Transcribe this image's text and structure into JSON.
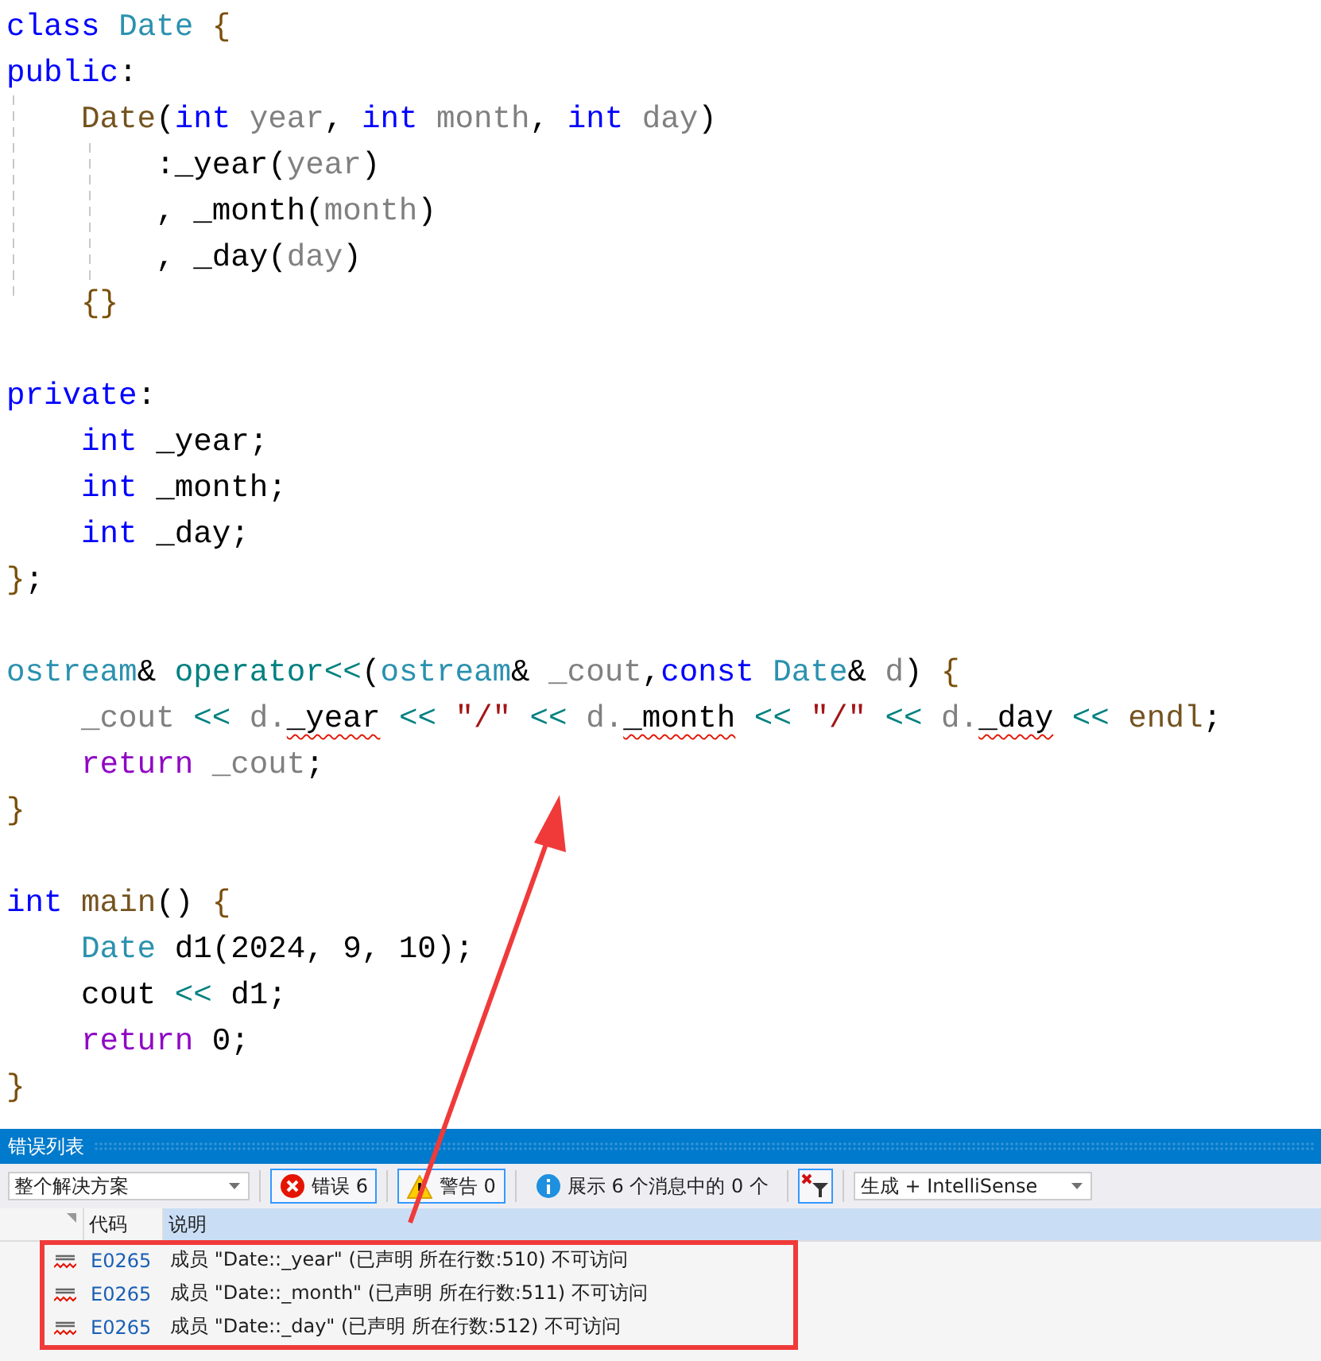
{
  "editor": {
    "lines": [
      {
        "kind": "code",
        "tokens": [
          {
            "kind": "kw",
            "text": "class "
          },
          {
            "kind": "type",
            "text": "Date "
          },
          {
            "kind": "brace",
            "text": "{"
          }
        ]
      },
      {
        "kind": "code",
        "tokens": [
          {
            "kind": "kw",
            "text": "public"
          },
          {
            "kind": "plain",
            "text": ":"
          }
        ]
      },
      {
        "kind": "code",
        "tokens": [
          {
            "kind": "fn",
            "text": "    Date"
          },
          {
            "kind": "plain",
            "text": "("
          },
          {
            "kind": "kw",
            "text": "int "
          },
          {
            "kind": "param",
            "text": "year"
          },
          {
            "kind": "plain",
            "text": ", "
          },
          {
            "kind": "kw",
            "text": "int "
          },
          {
            "kind": "param",
            "text": "month"
          },
          {
            "kind": "plain",
            "text": ", "
          },
          {
            "kind": "kw",
            "text": "int "
          },
          {
            "kind": "param",
            "text": "day"
          },
          {
            "kind": "plain",
            "text": ")"
          }
        ]
      },
      {
        "kind": "code",
        "tokens": [
          {
            "kind": "plain",
            "text": "        :_year("
          },
          {
            "kind": "param",
            "text": "year"
          },
          {
            "kind": "plain",
            "text": ")"
          }
        ]
      },
      {
        "kind": "code",
        "tokens": [
          {
            "kind": "plain",
            "text": "        , _month("
          },
          {
            "kind": "param",
            "text": "month"
          },
          {
            "kind": "plain",
            "text": ")"
          }
        ]
      },
      {
        "kind": "code",
        "tokens": [
          {
            "kind": "plain",
            "text": "        , _day("
          },
          {
            "kind": "param",
            "text": "day"
          },
          {
            "kind": "plain",
            "text": ")"
          }
        ]
      },
      {
        "kind": "code",
        "tokens": [
          {
            "kind": "brace",
            "text": "    {}"
          }
        ]
      },
      {
        "kind": "blank"
      },
      {
        "kind": "code",
        "tokens": [
          {
            "kind": "kw",
            "text": "private"
          },
          {
            "kind": "plain",
            "text": ":"
          }
        ]
      },
      {
        "kind": "code",
        "tokens": [
          {
            "kind": "kw",
            "text": "    int "
          },
          {
            "kind": "plain",
            "text": "_year;"
          }
        ]
      },
      {
        "kind": "code",
        "tokens": [
          {
            "kind": "kw",
            "text": "    int "
          },
          {
            "kind": "plain",
            "text": "_month;"
          }
        ]
      },
      {
        "kind": "code",
        "tokens": [
          {
            "kind": "kw",
            "text": "    int "
          },
          {
            "kind": "plain",
            "text": "_day;"
          }
        ]
      },
      {
        "kind": "code",
        "tokens": [
          {
            "kind": "brace",
            "text": "}"
          },
          {
            "kind": "plain",
            "text": ";"
          }
        ]
      },
      {
        "kind": "blank"
      },
      {
        "kind": "code",
        "tokens": [
          {
            "kind": "type",
            "text": "ostream"
          },
          {
            "kind": "plain",
            "text": "& "
          },
          {
            "kind": "op",
            "text": "operator<<"
          },
          {
            "kind": "plain",
            "text": "("
          },
          {
            "kind": "type",
            "text": "ostream"
          },
          {
            "kind": "plain",
            "text": "& "
          },
          {
            "kind": "param",
            "text": "_cout"
          },
          {
            "kind": "plain",
            "text": ","
          },
          {
            "kind": "kw",
            "text": "const "
          },
          {
            "kind": "type",
            "text": "Date"
          },
          {
            "kind": "plain",
            "text": "& "
          },
          {
            "kind": "param",
            "text": "d"
          },
          {
            "kind": "plain",
            "text": ") "
          },
          {
            "kind": "brace",
            "text": "{"
          }
        ]
      },
      {
        "kind": "code",
        "tokens": [
          {
            "kind": "param",
            "text": "    _cout "
          },
          {
            "kind": "op",
            "text": "<< "
          },
          {
            "kind": "param",
            "text": "d."
          },
          {
            "kind": "plain",
            "text": "_year",
            "error": true
          },
          {
            "kind": "op",
            "text": " << "
          },
          {
            "kind": "str",
            "text": "\"/\""
          },
          {
            "kind": "op",
            "text": " << "
          },
          {
            "kind": "param",
            "text": "d."
          },
          {
            "kind": "plain",
            "text": "_month",
            "error": true
          },
          {
            "kind": "op",
            "text": " << "
          },
          {
            "kind": "str",
            "text": "\"/\""
          },
          {
            "kind": "op",
            "text": " << "
          },
          {
            "kind": "param",
            "text": "d."
          },
          {
            "kind": "plain",
            "text": "_day",
            "error": true
          },
          {
            "kind": "op",
            "text": " << "
          },
          {
            "kind": "fn",
            "text": "endl"
          },
          {
            "kind": "plain",
            "text": ";"
          }
        ]
      },
      {
        "kind": "code",
        "tokens": [
          {
            "kind": "ctrl",
            "text": "    return "
          },
          {
            "kind": "param",
            "text": "_cout"
          },
          {
            "kind": "plain",
            "text": ";"
          }
        ]
      },
      {
        "kind": "code",
        "tokens": [
          {
            "kind": "brace",
            "text": "}"
          }
        ]
      },
      {
        "kind": "blank"
      },
      {
        "kind": "code",
        "tokens": [
          {
            "kind": "kw",
            "text": "int "
          },
          {
            "kind": "fn",
            "text": "main"
          },
          {
            "kind": "plain",
            "text": "() "
          },
          {
            "kind": "brace",
            "text": "{"
          }
        ]
      },
      {
        "kind": "code",
        "tokens": [
          {
            "kind": "type",
            "text": "    Date "
          },
          {
            "kind": "plain",
            "text": "d1(2024, 9, 10);"
          }
        ]
      },
      {
        "kind": "code",
        "tokens": [
          {
            "kind": "plain",
            "text": "    cout "
          },
          {
            "kind": "op",
            "text": "<<"
          },
          {
            "kind": "plain",
            "text": " d1;"
          }
        ]
      },
      {
        "kind": "code",
        "tokens": [
          {
            "kind": "ctrl",
            "text": "    return "
          },
          {
            "kind": "plain",
            "text": "0;"
          }
        ]
      },
      {
        "kind": "code",
        "tokens": [
          {
            "kind": "brace",
            "text": "}"
          }
        ]
      }
    ]
  },
  "error_list": {
    "title": "错误列表",
    "scope": "整个解决方案",
    "filters": [
      {
        "kind": "error",
        "label": "错误 6",
        "selected": true
      },
      {
        "kind": "warning",
        "label": "警告 0",
        "selected": true
      },
      {
        "kind": "info",
        "label": "展示 6 个消息中的 0 个",
        "selected": false
      }
    ],
    "source": "生成 + IntelliSense",
    "columns": [
      {
        "label": "代码",
        "selected": false
      },
      {
        "label": "说明",
        "selected": true
      }
    ],
    "rows": [
      {
        "code": "E0265",
        "description": "成员 \"Date::_year\" (已声明 所在行数:510) 不可访问"
      },
      {
        "code": "E0265",
        "description": "成员 \"Date::_month\" (已声明 所在行数:511) 不可访问"
      },
      {
        "code": "E0265",
        "description": "成员 \"Date::_day\" (已声明 所在行数:512) 不可访问"
      }
    ]
  }
}
